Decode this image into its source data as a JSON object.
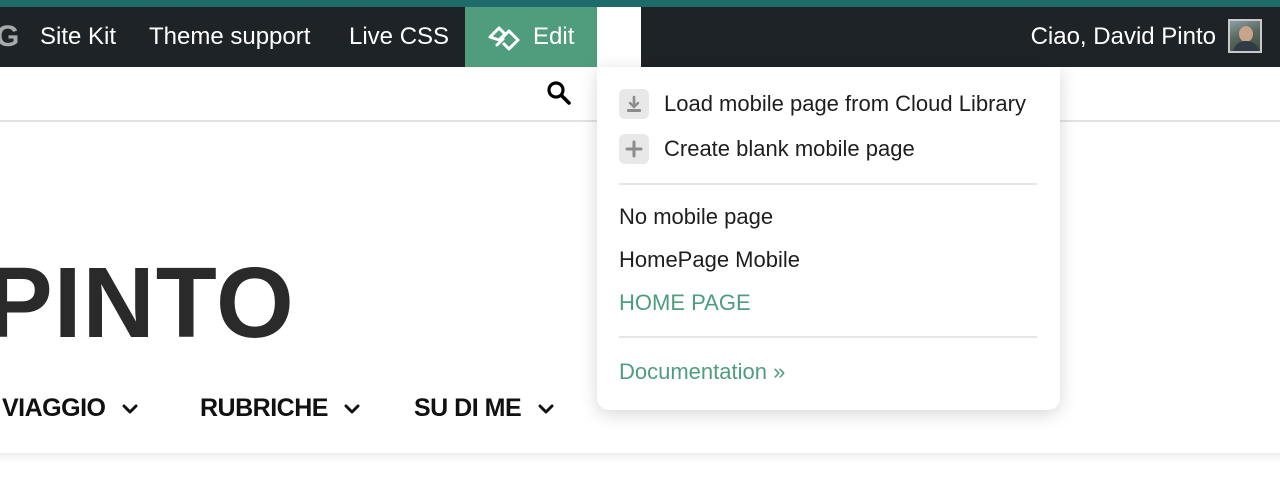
{
  "admin_bar": {
    "google_logo": "G",
    "items": [
      "Site Kit",
      "Theme support",
      "Live CSS"
    ],
    "edit_label": "Edit",
    "greeting": "Ciao, David Pinto",
    "colors": {
      "bar": "#1e2327",
      "edit_accent": "#4f9d7c",
      "top_strip": "#1f6b6b"
    }
  },
  "site": {
    "title": "PINTO",
    "nav": [
      "VIAGGIO",
      "RUBRICHE",
      "SU DI ME"
    ],
    "search_icon": "search-icon"
  },
  "dropdown": {
    "actions": [
      {
        "icon": "download-icon",
        "label": "Load mobile page from Cloud Library"
      },
      {
        "icon": "plus-icon",
        "label": "Create blank mobile page"
      }
    ],
    "pages": [
      {
        "label": "No mobile page",
        "active": false
      },
      {
        "label": "HomePage Mobile",
        "active": false
      },
      {
        "label": "HOME PAGE",
        "active": true
      }
    ],
    "documentation": "Documentation »",
    "colors": {
      "link": "#4f9d7c"
    }
  }
}
